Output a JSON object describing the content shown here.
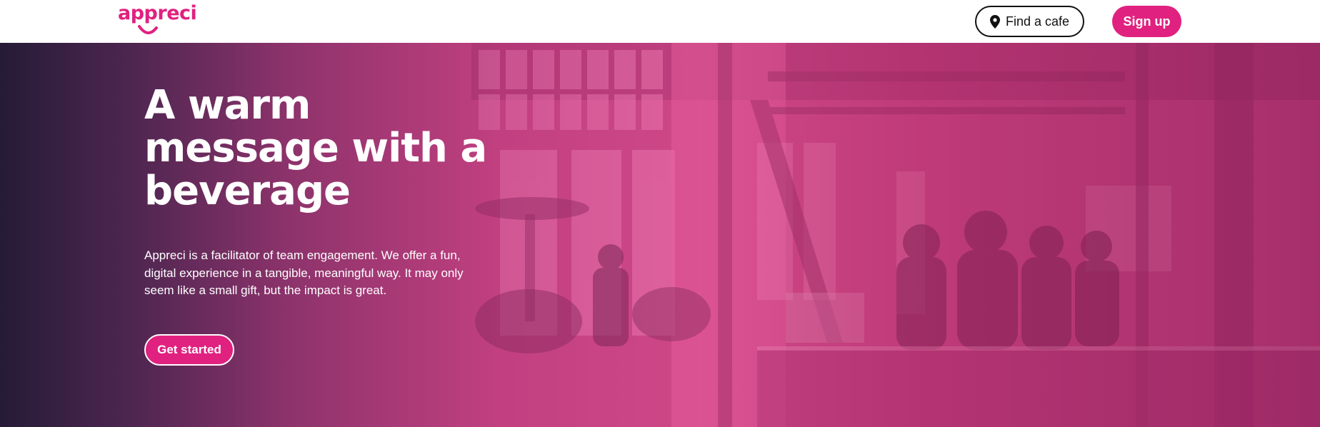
{
  "header": {
    "logo_text": "appreci",
    "find_cafe_label": "Find a cafe",
    "signup_label": "Sign up"
  },
  "hero": {
    "title": "A warm message with a beverage",
    "description": "Appreci is a facilitator of team engagement. We offer a fun, digital experience in a tangible, meaningful way. It may only seem like a small gift, but the impact is great.",
    "cta_label": "Get started"
  },
  "icons": {
    "find_cafe": "map-pin-icon",
    "logo": "smile-icon"
  },
  "colors": {
    "brand": "#e0217f",
    "header_bg": "#ffffff",
    "hero_dark": "#201a34",
    "hero_pink": "#e65096",
    "text_on_hero": "#ffffff"
  }
}
